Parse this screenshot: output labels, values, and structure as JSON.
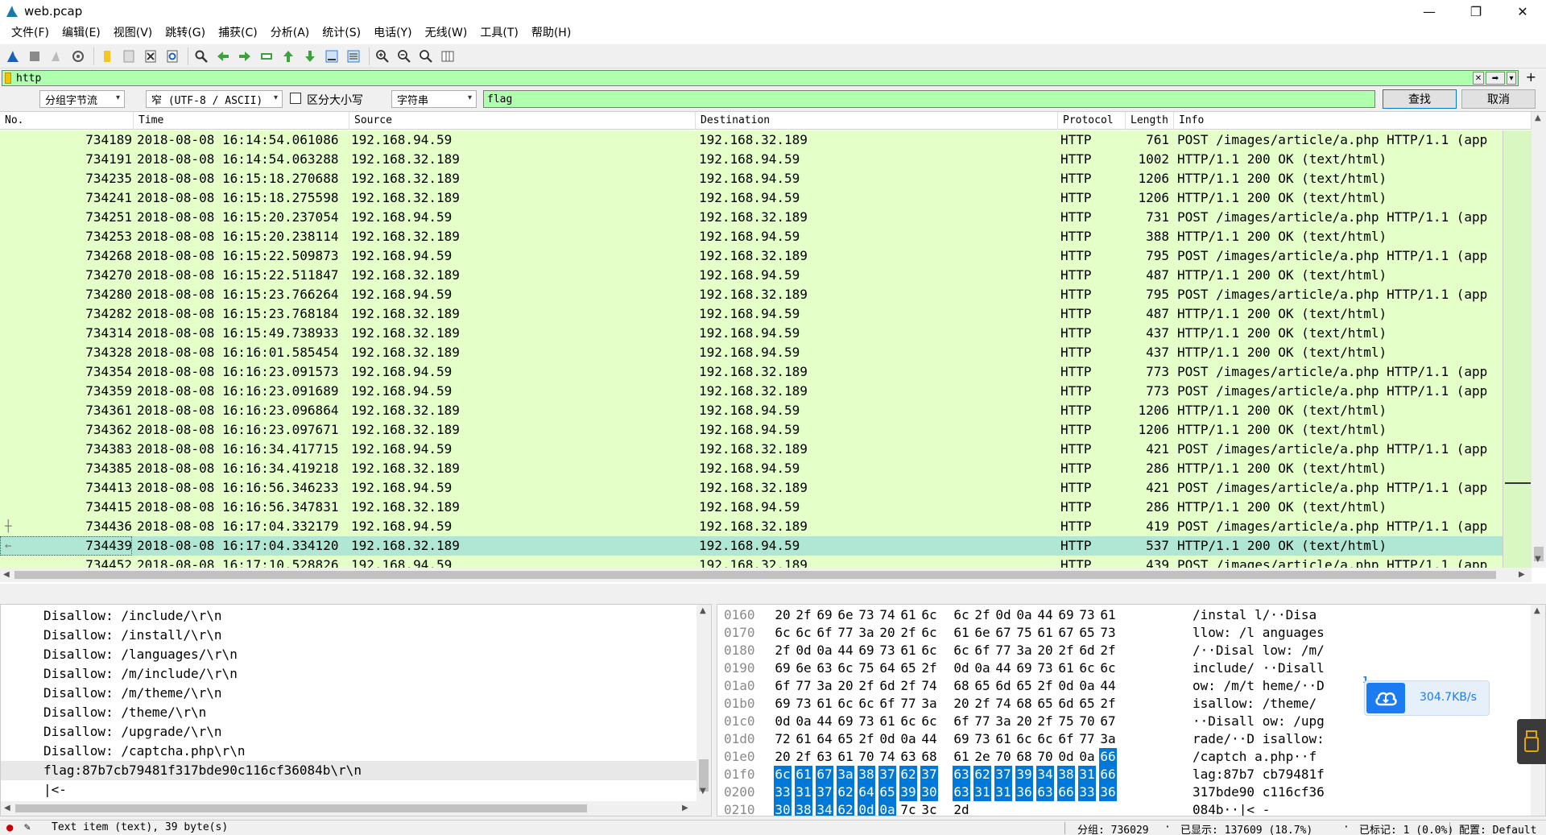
{
  "window": {
    "title": "web.pcap",
    "minimize": "—",
    "maximize": "❐",
    "close": "✕"
  },
  "menu": [
    "文件(F)",
    "编辑(E)",
    "视图(V)",
    "跳转(G)",
    "捕获(C)",
    "分析(A)",
    "统计(S)",
    "电话(Y)",
    "无线(W)",
    "工具(T)",
    "帮助(H)"
  ],
  "filter": {
    "value": "http",
    "plus": "+"
  },
  "find": {
    "scope": "分组字节流",
    "encoding": "窄 (UTF-8 / ASCII)",
    "case_label": "区分大小写",
    "type": "字符串",
    "query": "flag",
    "find_label": "查找",
    "cancel_label": "取消"
  },
  "columns": [
    "No.",
    "Time",
    "Source",
    "Destination",
    "Protocol",
    "Length",
    "Info"
  ],
  "packets": [
    {
      "no": "734189",
      "time": "2018-08-08 16:14:54.061086",
      "src": "192.168.94.59",
      "dst": "192.168.32.189",
      "proto": "HTTP",
      "len": "761",
      "info": "POST /images/article/a.php HTTP/1.1  (app"
    },
    {
      "no": "734191",
      "time": "2018-08-08 16:14:54.063288",
      "src": "192.168.32.189",
      "dst": "192.168.94.59",
      "proto": "HTTP",
      "len": "1002",
      "info": "HTTP/1.1 200 OK  (text/html)"
    },
    {
      "no": "734235",
      "time": "2018-08-08 16:15:18.270688",
      "src": "192.168.32.189",
      "dst": "192.168.94.59",
      "proto": "HTTP",
      "len": "1206",
      "info": "HTTP/1.1 200 OK  (text/html)"
    },
    {
      "no": "734241",
      "time": "2018-08-08 16:15:18.275598",
      "src": "192.168.32.189",
      "dst": "192.168.94.59",
      "proto": "HTTP",
      "len": "1206",
      "info": "HTTP/1.1 200 OK  (text/html)"
    },
    {
      "no": "734251",
      "time": "2018-08-08 16:15:20.237054",
      "src": "192.168.94.59",
      "dst": "192.168.32.189",
      "proto": "HTTP",
      "len": "731",
      "info": "POST /images/article/a.php HTTP/1.1  (app"
    },
    {
      "no": "734253",
      "time": "2018-08-08 16:15:20.238114",
      "src": "192.168.32.189",
      "dst": "192.168.94.59",
      "proto": "HTTP",
      "len": "388",
      "info": "HTTP/1.1 200 OK  (text/html)"
    },
    {
      "no": "734268",
      "time": "2018-08-08 16:15:22.509873",
      "src": "192.168.94.59",
      "dst": "192.168.32.189",
      "proto": "HTTP",
      "len": "795",
      "info": "POST /images/article/a.php HTTP/1.1  (app"
    },
    {
      "no": "734270",
      "time": "2018-08-08 16:15:22.511847",
      "src": "192.168.32.189",
      "dst": "192.168.94.59",
      "proto": "HTTP",
      "len": "487",
      "info": "HTTP/1.1 200 OK  (text/html)"
    },
    {
      "no": "734280",
      "time": "2018-08-08 16:15:23.766264",
      "src": "192.168.94.59",
      "dst": "192.168.32.189",
      "proto": "HTTP",
      "len": "795",
      "info": "POST /images/article/a.php HTTP/1.1  (app"
    },
    {
      "no": "734282",
      "time": "2018-08-08 16:15:23.768184",
      "src": "192.168.32.189",
      "dst": "192.168.94.59",
      "proto": "HTTP",
      "len": "487",
      "info": "HTTP/1.1 200 OK  (text/html)"
    },
    {
      "no": "734314",
      "time": "2018-08-08 16:15:49.738933",
      "src": "192.168.32.189",
      "dst": "192.168.94.59",
      "proto": "HTTP",
      "len": "437",
      "info": "HTTP/1.1 200 OK  (text/html)"
    },
    {
      "no": "734328",
      "time": "2018-08-08 16:16:01.585454",
      "src": "192.168.32.189",
      "dst": "192.168.94.59",
      "proto": "HTTP",
      "len": "437",
      "info": "HTTP/1.1 200 OK  (text/html)"
    },
    {
      "no": "734354",
      "time": "2018-08-08 16:16:23.091573",
      "src": "192.168.94.59",
      "dst": "192.168.32.189",
      "proto": "HTTP",
      "len": "773",
      "info": "POST /images/article/a.php HTTP/1.1  (app"
    },
    {
      "no": "734359",
      "time": "2018-08-08 16:16:23.091689",
      "src": "192.168.94.59",
      "dst": "192.168.32.189",
      "proto": "HTTP",
      "len": "773",
      "info": "POST /images/article/a.php HTTP/1.1  (app"
    },
    {
      "no": "734361",
      "time": "2018-08-08 16:16:23.096864",
      "src": "192.168.32.189",
      "dst": "192.168.94.59",
      "proto": "HTTP",
      "len": "1206",
      "info": "HTTP/1.1 200 OK  (text/html)"
    },
    {
      "no": "734362",
      "time": "2018-08-08 16:16:23.097671",
      "src": "192.168.32.189",
      "dst": "192.168.94.59",
      "proto": "HTTP",
      "len": "1206",
      "info": "HTTP/1.1 200 OK  (text/html)"
    },
    {
      "no": "734383",
      "time": "2018-08-08 16:16:34.417715",
      "src": "192.168.94.59",
      "dst": "192.168.32.189",
      "proto": "HTTP",
      "len": "421",
      "info": "POST /images/article/a.php HTTP/1.1  (app"
    },
    {
      "no": "734385",
      "time": "2018-08-08 16:16:34.419218",
      "src": "192.168.32.189",
      "dst": "192.168.94.59",
      "proto": "HTTP",
      "len": "286",
      "info": "HTTP/1.1 200 OK  (text/html)"
    },
    {
      "no": "734413",
      "time": "2018-08-08 16:16:56.346233",
      "src": "192.168.94.59",
      "dst": "192.168.32.189",
      "proto": "HTTP",
      "len": "421",
      "info": "POST /images/article/a.php HTTP/1.1  (app"
    },
    {
      "no": "734415",
      "time": "2018-08-08 16:16:56.347831",
      "src": "192.168.32.189",
      "dst": "192.168.94.59",
      "proto": "HTTP",
      "len": "286",
      "info": "HTTP/1.1 200 OK  (text/html)"
    },
    {
      "no": "734436",
      "time": "2018-08-08 16:17:04.332179",
      "src": "192.168.94.59",
      "dst": "192.168.32.189",
      "proto": "HTTP",
      "len": "419",
      "info": "POST /images/article/a.php HTTP/1.1  (app"
    },
    {
      "no": "734439",
      "time": "2018-08-08 16:17:04.334120",
      "src": "192.168.32.189",
      "dst": "192.168.94.59",
      "proto": "HTTP",
      "len": "537",
      "info": "HTTP/1.1 200 OK  (text/html)",
      "selected": true
    },
    {
      "no": "734452",
      "time": "2018-08-08 16:17:10.528826",
      "src": "192.168.94.59",
      "dst": "192.168.32.189",
      "proto": "HTTP",
      "len": "439",
      "info": "POST /images/article/a.php HTTP/1.1  (app"
    }
  ],
  "details": [
    "Disallow: /include/\\r\\n",
    "Disallow: /install/\\r\\n",
    "Disallow: /languages/\\r\\n",
    "Disallow: /m/include/\\r\\n",
    "Disallow: /m/theme/\\r\\n",
    "Disallow: /theme/\\r\\n",
    "Disallow: /upgrade/\\r\\n",
    "Disallow: /captcha.php\\r\\n",
    "flag:87b7cb79481f317bde90c116cf36084b\\r\\n",
    "|<-"
  ],
  "details_highlight_index": 8,
  "bytes": [
    {
      "off": "0160",
      "hex": [
        "20",
        "2f",
        "69",
        "6e",
        "73",
        "74",
        "61",
        "6c",
        "6c",
        "2f",
        "0d",
        "0a",
        "44",
        "69",
        "73",
        "61"
      ],
      "ascii": " /instal l/··Disa",
      "sel_from": -1
    },
    {
      "off": "0170",
      "hex": [
        "6c",
        "6c",
        "6f",
        "77",
        "3a",
        "20",
        "2f",
        "6c",
        "61",
        "6e",
        "67",
        "75",
        "61",
        "67",
        "65",
        "73"
      ],
      "ascii": "llow: /l anguages",
      "sel_from": -1
    },
    {
      "off": "0180",
      "hex": [
        "2f",
        "0d",
        "0a",
        "44",
        "69",
        "73",
        "61",
        "6c",
        "6c",
        "6f",
        "77",
        "3a",
        "20",
        "2f",
        "6d",
        "2f"
      ],
      "ascii": "/··Disal low: /m/",
      "sel_from": -1
    },
    {
      "off": "0190",
      "hex": [
        "69",
        "6e",
        "63",
        "6c",
        "75",
        "64",
        "65",
        "2f",
        "0d",
        "0a",
        "44",
        "69",
        "73",
        "61",
        "6c",
        "6c"
      ],
      "ascii": "include/ ··Disall",
      "sel_from": -1
    },
    {
      "off": "01a0",
      "hex": [
        "6f",
        "77",
        "3a",
        "20",
        "2f",
        "6d",
        "2f",
        "74",
        "68",
        "65",
        "6d",
        "65",
        "2f",
        "0d",
        "0a",
        "44"
      ],
      "ascii": "ow: /m/t heme/··D",
      "sel_from": -1
    },
    {
      "off": "01b0",
      "hex": [
        "69",
        "73",
        "61",
        "6c",
        "6c",
        "6f",
        "77",
        "3a",
        "20",
        "2f",
        "74",
        "68",
        "65",
        "6d",
        "65",
        "2f"
      ],
      "ascii": "isallow:  /theme/",
      "sel_from": -1
    },
    {
      "off": "01c0",
      "hex": [
        "0d",
        "0a",
        "44",
        "69",
        "73",
        "61",
        "6c",
        "6c",
        "6f",
        "77",
        "3a",
        "20",
        "2f",
        "75",
        "70",
        "67"
      ],
      "ascii": "··Disall ow: /upg",
      "sel_from": -1
    },
    {
      "off": "01d0",
      "hex": [
        "72",
        "61",
        "64",
        "65",
        "2f",
        "0d",
        "0a",
        "44",
        "69",
        "73",
        "61",
        "6c",
        "6c",
        "6f",
        "77",
        "3a"
      ],
      "ascii": "rade/··D isallow:",
      "sel_from": -1
    },
    {
      "off": "01e0",
      "hex": [
        "20",
        "2f",
        "63",
        "61",
        "70",
        "74",
        "63",
        "68",
        "61",
        "2e",
        "70",
        "68",
        "70",
        "0d",
        "0a",
        "66"
      ],
      "ascii": " /captch a.php··f",
      "sel_from": 15
    },
    {
      "off": "01f0",
      "hex": [
        "6c",
        "61",
        "67",
        "3a",
        "38",
        "37",
        "62",
        "37",
        "63",
        "62",
        "37",
        "39",
        "34",
        "38",
        "31",
        "66"
      ],
      "ascii": "lag:87b7 cb79481f",
      "sel_from": 0
    },
    {
      "off": "0200",
      "hex": [
        "33",
        "31",
        "37",
        "62",
        "64",
        "65",
        "39",
        "30",
        "63",
        "31",
        "31",
        "36",
        "63",
        "66",
        "33",
        "36"
      ],
      "ascii": "317bde90 c116cf36",
      "sel_from": 0
    },
    {
      "off": "0210",
      "hex": [
        "30",
        "38",
        "34",
        "62",
        "0d",
        "0a",
        "7c",
        "3c",
        "2d"
      ],
      "ascii": "084b··|< -",
      "sel_to": 6
    }
  ],
  "download": {
    "badge": "1",
    "speed": "304.7KB/s"
  },
  "status": {
    "item": "Text item (text), 39 byte(s)",
    "packets": "分组: 736029",
    "displayed": "已显示: 137609 (18.7%)",
    "marked": "已标记: 1 (0.0%)",
    "profile": "配置: Default"
  }
}
